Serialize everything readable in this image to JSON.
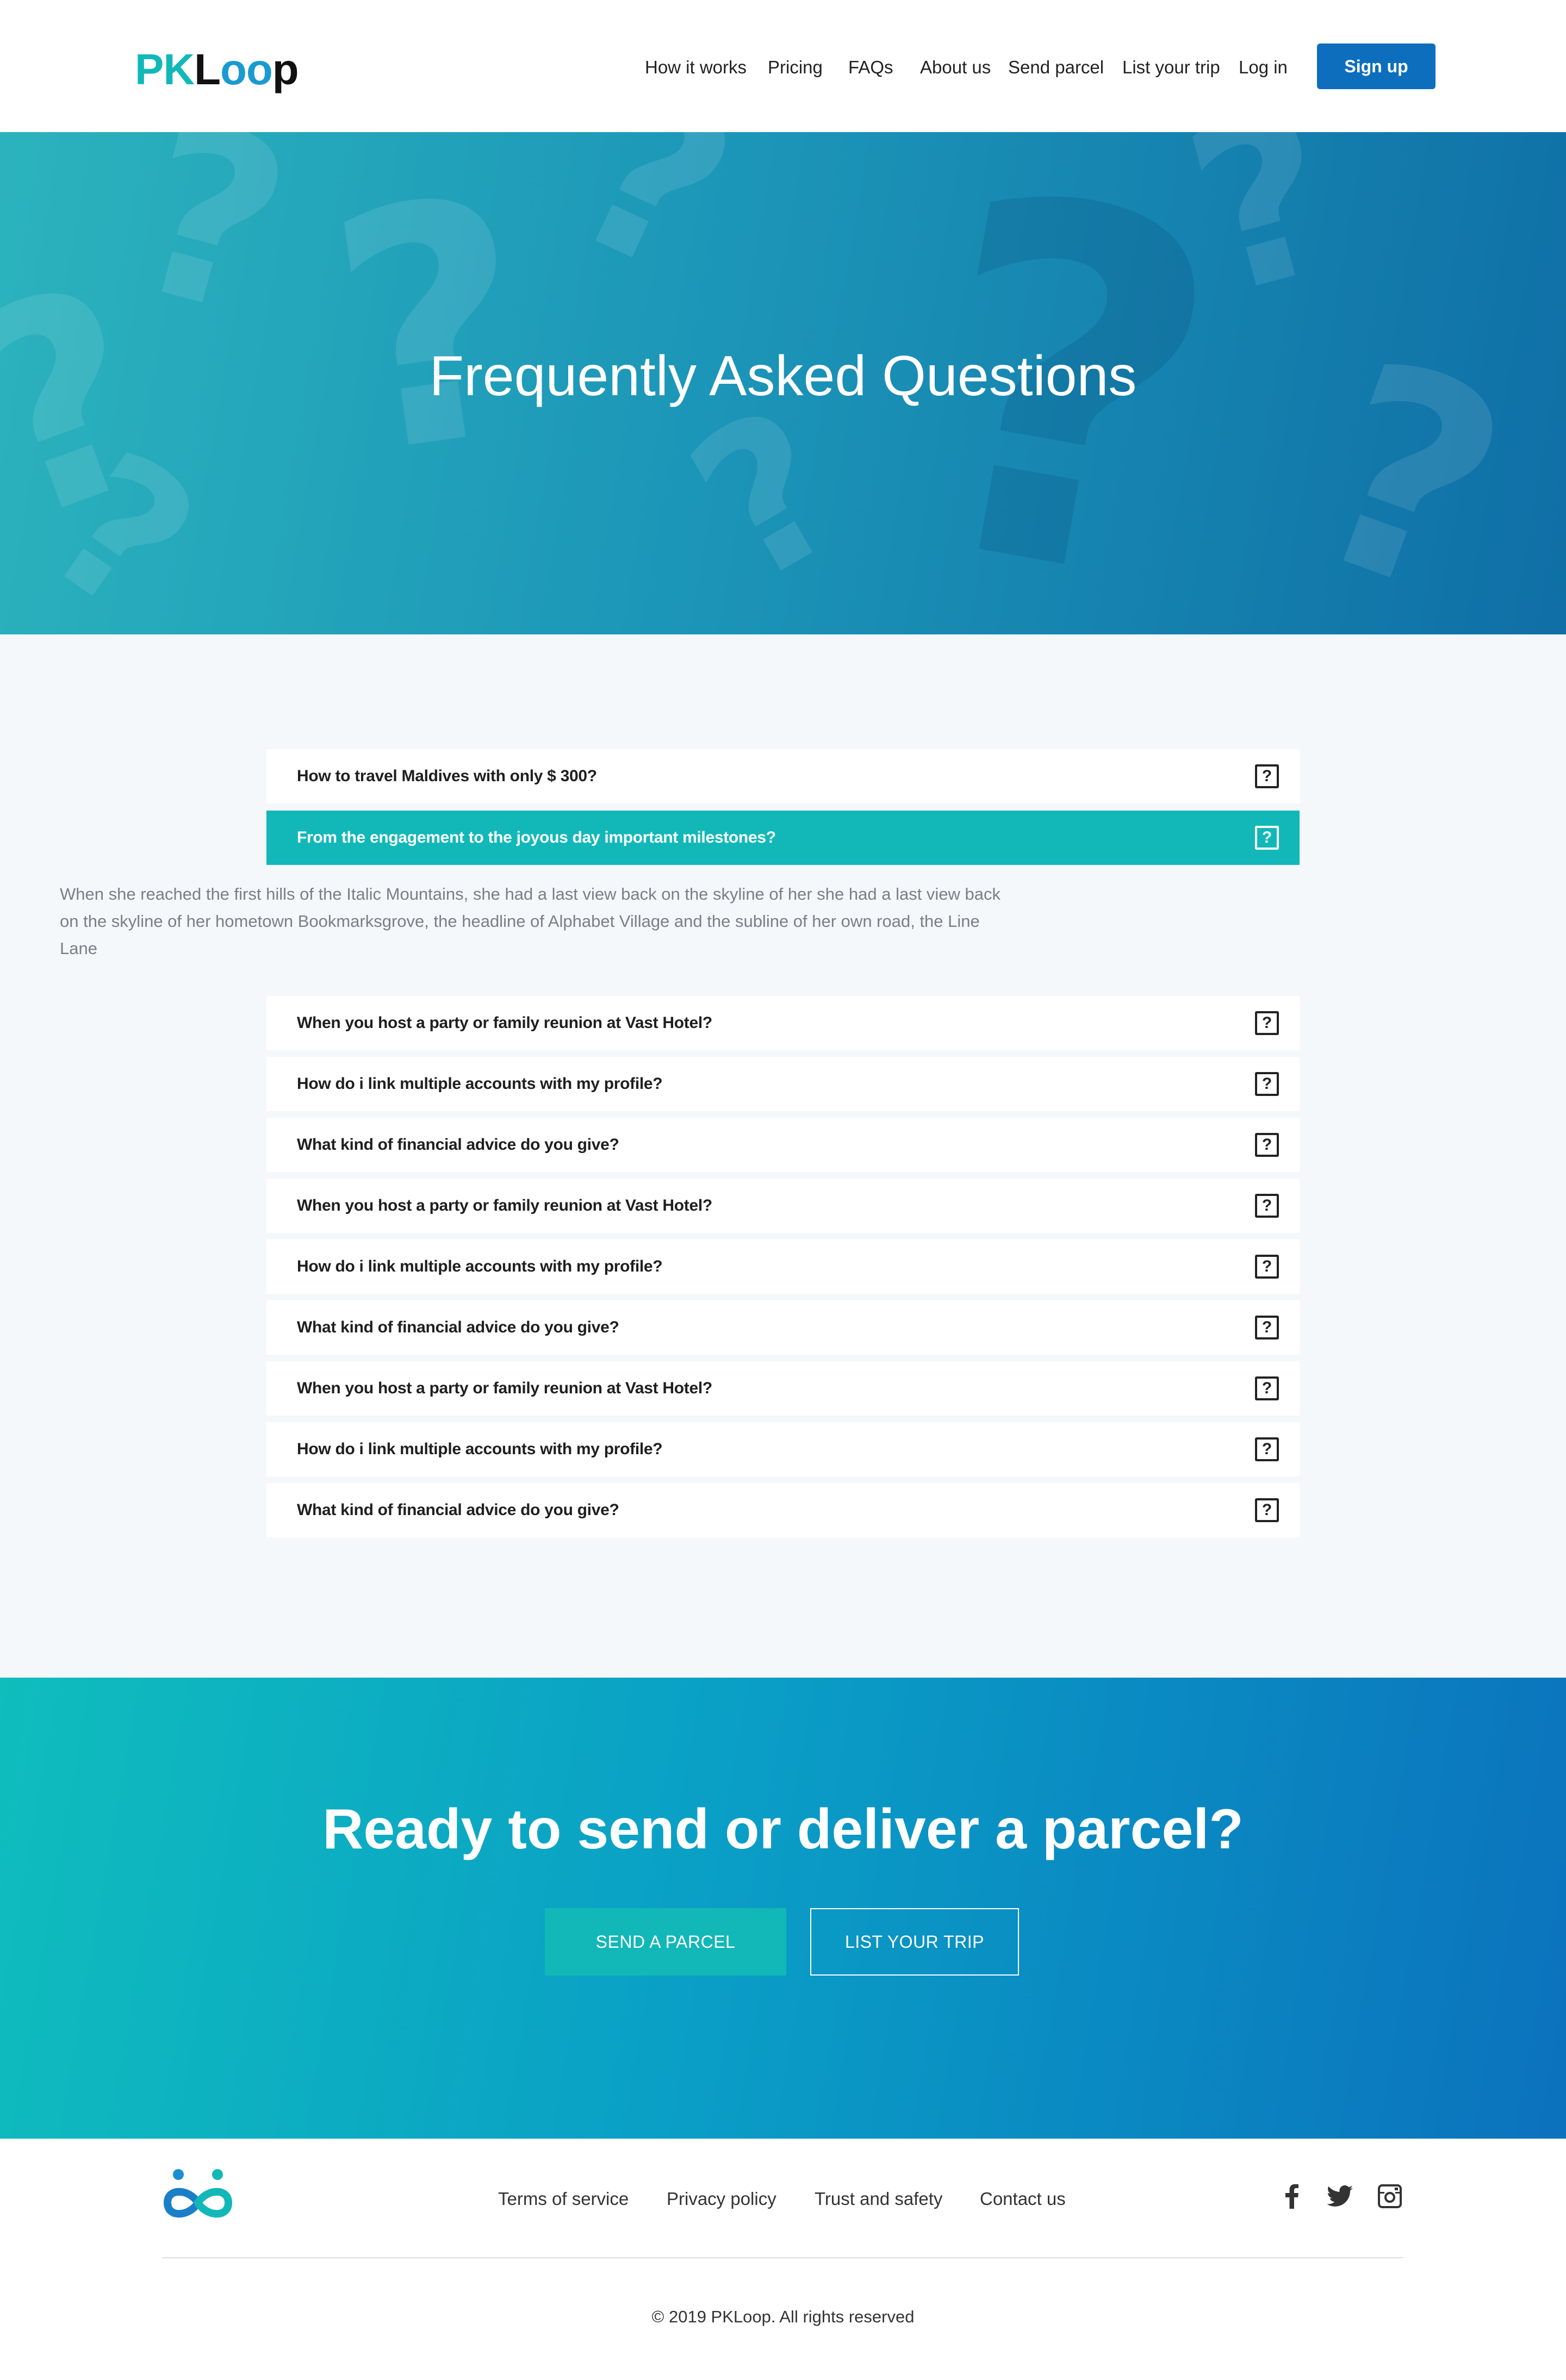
{
  "brand": {
    "name_parts": [
      "PK",
      "L",
      "oo",
      "p"
    ],
    "colors": {
      "teal": "#12b8b8",
      "blue": "#0d6ebd",
      "dark": "#222222"
    }
  },
  "nav": {
    "items": [
      "How it works",
      "Pricing",
      "FAQs",
      "About us",
      "Send parcel",
      "List your trip",
      "Log in"
    ],
    "signup": "Sign up"
  },
  "hero": {
    "title": "Frequently Asked Questions"
  },
  "faq": {
    "icon": "question-box-icon",
    "icon_glyph": "?",
    "items": [
      {
        "question": "How to travel Maldives with only $ 300?"
      },
      {
        "question": "From the engagement to the joyous day important milestones?",
        "active": true
      },
      {
        "question": "When you host a party or family reunion at Vast Hotel?"
      },
      {
        "question": "How do i link multiple accounts with my profile?"
      },
      {
        "question": "What kind of financial advice do you give?"
      },
      {
        "question": "When you host a party or family reunion at Vast Hotel?"
      },
      {
        "question": "How do i link multiple accounts with my profile?"
      },
      {
        "question": "What kind of financial advice do you give?"
      },
      {
        "question": "When you host a party or family reunion at Vast Hotel?"
      },
      {
        "question": "How do i link multiple accounts with my profile?"
      },
      {
        "question": "What kind of financial advice do you give?"
      }
    ],
    "answer": "When she reached the first hills of the Italic Mountains, she had a last view back on the skyline of her she had a last view back on the skyline of her hometown Bookmarksgrove, the headline of Alphabet Village and the subline of her own road, the Line Lane"
  },
  "cta": {
    "title": "Ready to send or deliver a parcel?",
    "send_button": "SEND A PARCEL",
    "trip_button": "LIST YOUR TRIP"
  },
  "footer": {
    "links": [
      "Terms of service",
      "Privacy policy",
      "Trust and safety",
      "Contact us"
    ],
    "social": [
      "facebook-icon",
      "twitter-icon",
      "instagram-icon"
    ],
    "copyright": "© 2019 PKLoop. All rights reserved"
  }
}
